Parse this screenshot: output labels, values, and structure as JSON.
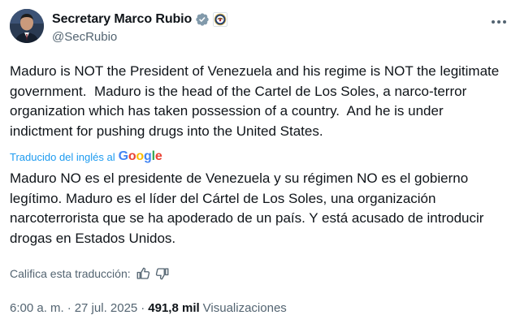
{
  "author": {
    "display_name": "Secretary Marco Rubio",
    "handle": "@SecRubio",
    "verified_badge_icon": "gray-verified-badge-icon",
    "affiliation_icon": "department-of-state-seal-icon",
    "avatar_icon": "profile-photo-avatar"
  },
  "tweet": {
    "original_text": "Maduro is NOT the President of Venezuela and his regime is NOT the legitimate government.  Maduro is the head of the Cartel de Los Soles, a narco-terror organization which has taken possession of a country.  And he is under indictment for pushing drugs into the United States.",
    "translation_credit_prefix": "Traducido del inglés al",
    "translation_provider": "Google",
    "translated_text": "Maduro NO es el presidente de Venezuela y su régimen NO es el gobierno legítimo. Maduro es el líder del Cártel de Los Soles, una organización narcoterrorista que se ha apoderado de un país. Y está acusado de introducir drogas en Estados Unidos.",
    "rate_translation_label": "Califica esta traducción:",
    "thumb_up_icon": "thumbs-up-icon",
    "thumb_down_icon": "thumbs-down-icon"
  },
  "meta": {
    "time": "6:00 a. m.",
    "separator": "·",
    "date": "27 jul. 2025",
    "views_count": "491,8 mil",
    "views_label": "Visualizaciones"
  },
  "colors": {
    "text": "#0f1419",
    "secondary": "#536471",
    "link": "#1d9bf0"
  }
}
